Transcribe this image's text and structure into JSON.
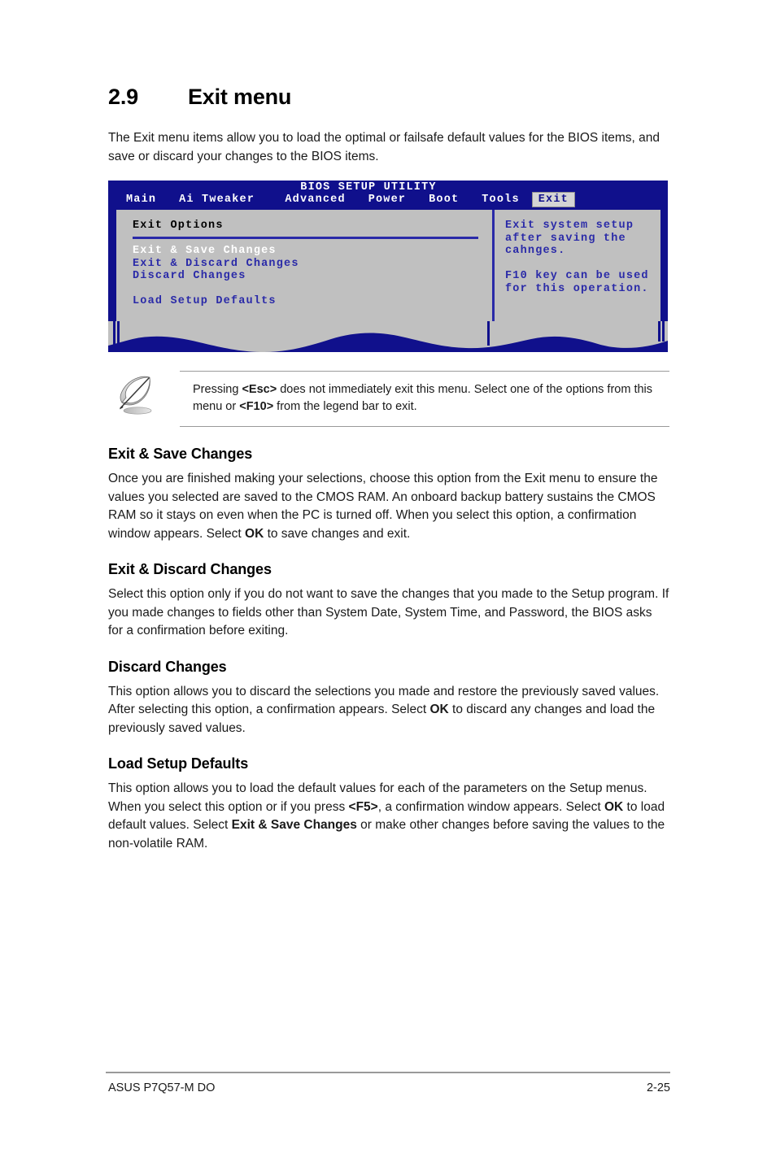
{
  "section": {
    "number": "2.9",
    "title": "Exit menu",
    "intro": "The Exit menu items allow you to load the optimal or failsafe default values for the BIOS items, and save or discard your changes to the BIOS items."
  },
  "bios": {
    "utility_title": "BIOS SETUP UTILITY",
    "tabs": [
      {
        "label": "Main",
        "active": false
      },
      {
        "label": "Ai Tweaker",
        "active": false
      },
      {
        "label": "Advanced",
        "active": false
      },
      {
        "label": "Power",
        "active": false
      },
      {
        "label": "Boot",
        "active": false
      },
      {
        "label": "Tools",
        "active": false
      },
      {
        "label": "Exit",
        "active": true
      }
    ],
    "panel_heading": "Exit Options",
    "items": [
      {
        "label": "Exit & Save Changes",
        "selected": true
      },
      {
        "label": "Exit & Discard Changes",
        "selected": false
      },
      {
        "label": "Discard Changes",
        "selected": false
      },
      {
        "label": "Load Setup Defaults",
        "selected": false
      }
    ],
    "help_line1": "Exit system setup",
    "help_line2": "after saving the",
    "help_line3": "cahnges.",
    "help_line4": "F10 key can be used",
    "help_line5": "for this operation.",
    "colors": {
      "header_blue": "#10108c",
      "panel_gray": "#c0c0c0",
      "text_blue": "#2a2aa8",
      "tab_active_bg": "#d4d4d4"
    }
  },
  "note": {
    "icon": "quill-pen-icon",
    "text_part1": "Pressing ",
    "key1": "<Esc>",
    "text_part2": " does not immediately exit this menu. Select one of the options from this menu or ",
    "key2": "<F10>",
    "text_part3": " from the legend bar to exit."
  },
  "sections": [
    {
      "heading": "Exit & Save Changes",
      "paragraph_pre": "Once you are finished making your selections, choose this option from the Exit menu to ensure the values you selected are saved to the CMOS RAM. An onboard backup battery sustains the CMOS RAM so it stays on even when the PC is turned off. When you select this option, a confirmation window appears. Select ",
      "paragraph_bold": "OK",
      "paragraph_post": " to save changes and exit."
    },
    {
      "heading": "Exit & Discard Changes",
      "paragraph_pre": "Select this option only if you do not want to save the changes that you made to the Setup program. If you made changes to fields other than System Date, System Time, and Password, the BIOS asks for a confirmation before exiting.",
      "paragraph_bold": "",
      "paragraph_post": ""
    },
    {
      "heading": "Discard Changes",
      "paragraph_pre": "This option allows you to discard the selections you made and restore the previously saved values. After selecting this option, a confirmation appears. Select ",
      "paragraph_bold": "OK",
      "paragraph_post": " to discard any changes and load the previously saved values."
    },
    {
      "heading": "Load Setup Defaults",
      "paragraph_pre": "This option allows you to load the default values for each of the parameters on the Setup menus. When you select this option or if you press ",
      "paragraph_bold": "<F5>",
      "paragraph_post": ", a confirmation window appears. Select ",
      "paragraph_bold2": "OK",
      "paragraph_post2": " to load default values. Select ",
      "paragraph_bold3": "Exit & Save Changes",
      "paragraph_post3": " or make other changes before saving the values to the non-volatile RAM."
    }
  ],
  "footer": {
    "left": "ASUS P7Q57-M DO",
    "right": "2-25"
  }
}
